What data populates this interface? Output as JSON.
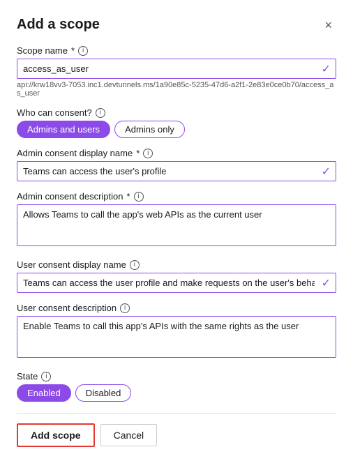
{
  "dialog": {
    "title": "Add a scope",
    "close_label": "×"
  },
  "scope_name": {
    "label": "Scope name",
    "required": "*",
    "value": "access_as_user",
    "api_url": "api://krw18vv3-7053.inc1.devtunnels.ms/1a90e85c-5235-47d6-a2f1-2e83e0ce0b70/access_as_user",
    "check_icon": "✓"
  },
  "who_can_consent": {
    "label": "Who can consent?",
    "buttons": [
      {
        "label": "Admins and users",
        "active": true
      },
      {
        "label": "Admins only",
        "active": false
      }
    ]
  },
  "admin_consent_display_name": {
    "label": "Admin consent display name",
    "required": "*",
    "value": "Teams can access the user's profile",
    "check_icon": "✓"
  },
  "admin_consent_description": {
    "label": "Admin consent description",
    "required": "*",
    "value": "Allows Teams to call the app's web APIs as the current user"
  },
  "user_consent_display_name": {
    "label": "User consent display name",
    "value": "Teams can access the user profile and make requests on the user's behalf",
    "check_icon": "✓"
  },
  "user_consent_description": {
    "label": "User consent description",
    "value": "Enable Teams to call this app's APIs with the same rights as the user"
  },
  "state": {
    "label": "State",
    "buttons": [
      {
        "label": "Enabled",
        "active": true
      },
      {
        "label": "Disabled",
        "active": false
      }
    ]
  },
  "footer": {
    "add_scope_label": "Add scope",
    "cancel_label": "Cancel"
  },
  "info_icon_text": "i"
}
